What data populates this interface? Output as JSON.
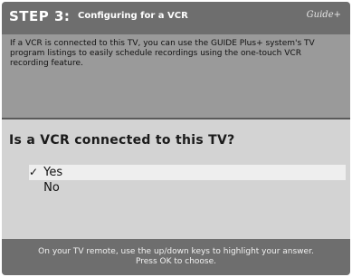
{
  "header": {
    "step": "STEP 3:",
    "title": "Configuring for a VCR",
    "logo": "Guide+"
  },
  "intro": {
    "text": "If a VCR is connected to this TV, you can use the GUIDE Plus+ system's TV program listings to easily schedule recordings using the one-touch VCR recording feature."
  },
  "question": {
    "text": "Is a VCR connected to this TV?"
  },
  "options": [
    {
      "label": "Yes",
      "check": "✓",
      "selected": true
    },
    {
      "label": "No",
      "check": "",
      "selected": false
    }
  ],
  "footer": {
    "line1": "On your TV remote, use the up/down keys to highlight your answer.",
    "line2": "Press OK to choose."
  },
  "colors": {
    "header_bg": "#6e6e6e",
    "intro_bg": "#9a9a9a",
    "body_bg": "#d3d3d3",
    "highlight_bg": "#eeeeee"
  }
}
